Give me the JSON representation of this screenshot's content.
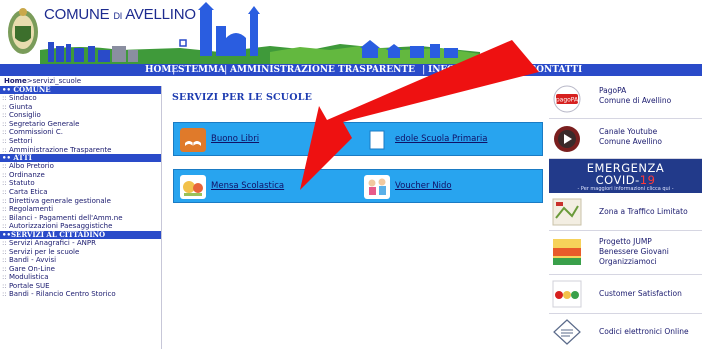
{
  "header": {
    "site_name_main": "COMUNE",
    "site_name_small": "DI",
    "site_name_city": "AVELLINO"
  },
  "navbar": {
    "items": [
      "HOME",
      "STEMMA",
      "AMMINISTRAZIONE TRASPARENTE",
      "INFORMA",
      "CONTATTI"
    ],
    "separator": "|"
  },
  "breadcrumb": {
    "home": "Home",
    "current": ">servizi_scuole"
  },
  "sidebar": {
    "prefix": "::",
    "sections": [
      {
        "title": "•• COMUNE",
        "items": [
          "Sindaco",
          "Giunta",
          "Consiglio",
          "Segretario Generale",
          "Commissioni C.",
          "Settori",
          "Amministrazione Trasparente"
        ]
      },
      {
        "title": "•• ATTI",
        "items": [
          "Albo Pretorio",
          "Ordinanze",
          "Statuto",
          "Carta Etica",
          "Direttiva generale gestionale",
          "Regolamenti",
          "Bilanci - Pagamenti dell'Amm.ne",
          "Autorizzazioni Paesaggistiche"
        ]
      },
      {
        "title": "••SERVIZI AL CITTADINO",
        "items": [
          "Servizi Anagrafici - ANPR",
          "Servizi per le scuole",
          "Bandi - Avvisi",
          "Gare On-Line",
          "Modulistica",
          "Portale SUE",
          "Bandi - Rilancio Centro Storico"
        ]
      }
    ]
  },
  "main": {
    "title": "SERVIZI PER LE SCUOLE",
    "tiles": [
      {
        "label": "Buono Libri",
        "icon": "book-icon"
      },
      {
        "label": "edole Scuola Primaria",
        "icon": "document-icon"
      },
      {
        "label": "Mensa Scolastica",
        "icon": "meal-icon"
      },
      {
        "label": "Voucher Nido",
        "icon": "children-icon"
      }
    ]
  },
  "right": {
    "pagopa_logo": "pagoPA",
    "pagopa_line1": "PagoPA",
    "pagopa_line2": "Comune di Avellino",
    "youtube_line1": "Canale Youtube",
    "youtube_line2": "Comune Avellino",
    "covid_line1": "EMERGENZA",
    "covid_line2a": "COVID-",
    "covid_line2b": "19",
    "covid_line3": "- Per maggiori informazioni clicca qui -",
    "ztl": "Zona a Traffico Limitato",
    "jump_line1": "Progetto JUMP",
    "jump_line2": "Benessere Giovani",
    "jump_line3": "Organizziamoci",
    "customer": "Customer Satisfaction",
    "codici": "Codici elettronici Online"
  },
  "colors": {
    "nav_blue": "#2a4bc9",
    "panel_blue": "#28a4ef",
    "arrow_red": "#ee1111"
  }
}
